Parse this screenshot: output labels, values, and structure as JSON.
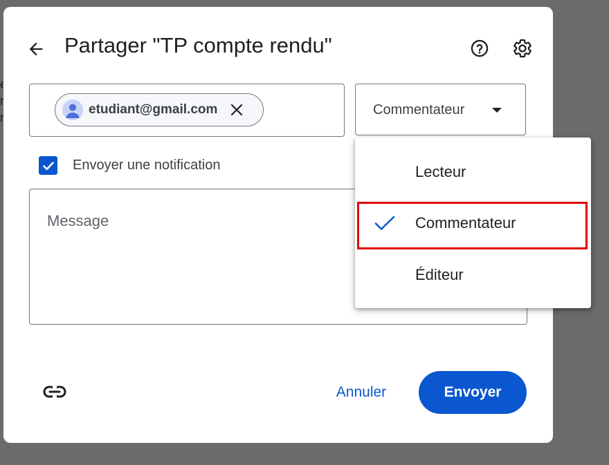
{
  "background": {
    "color": "#6b6b6b"
  },
  "dialog": {
    "title": "Partager \"TP compte rendu\"",
    "back_icon": "arrow-left-icon",
    "help_icon": "help-circle-icon",
    "settings_icon": "gear-icon"
  },
  "recipients": {
    "chips": [
      {
        "email": "etudiant@gmail.com",
        "avatar_icon": "person-avatar-icon",
        "remove_icon": "close-icon"
      }
    ]
  },
  "role_select": {
    "selected": "Commentateur",
    "arrow_icon": "caret-down-icon"
  },
  "notification": {
    "checked": true,
    "label": "Envoyer une notification"
  },
  "message": {
    "placeholder": "Message"
  },
  "footer": {
    "link_icon": "link-icon",
    "cancel_label": "Annuler",
    "send_label": "Envoyer"
  },
  "role_menu": {
    "items": [
      {
        "label": "Lecteur",
        "selected": false
      },
      {
        "label": "Commentateur",
        "selected": true
      },
      {
        "label": "Éditeur",
        "selected": false
      }
    ],
    "check_icon": "checkmark-icon"
  },
  "colors": {
    "accent": "#0b57d0",
    "highlight": "#e00000",
    "text": "#1f1f1f"
  }
}
